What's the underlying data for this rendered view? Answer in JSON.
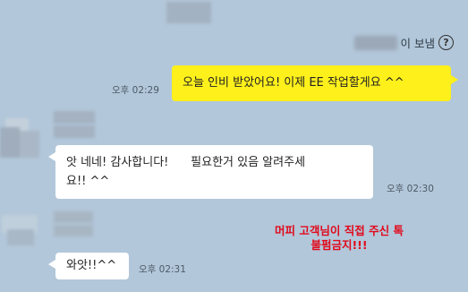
{
  "header": {
    "sent_to_suffix": "이 보냄",
    "help_icon": "question-circle-icon"
  },
  "messages": [
    {
      "side": "me",
      "text": "오늘 인비 받았어요! 이제 EE 작업할게요 ^^",
      "time": "오후 02:29"
    },
    {
      "side": "other",
      "text_line1": "앗 네네! 감사합니다!      필요한거 있음 알려주세",
      "text_line2": "요!! ^^",
      "time": "오후 02:30"
    },
    {
      "side": "other",
      "text": "와앗!!^^",
      "time": "오후 02:31"
    }
  ],
  "watermark": {
    "line1": "머피 고객님이 직접 주신 톡",
    "line2": "불펌금지!!!",
    "color": "#e1091b"
  },
  "colors": {
    "background": "#b2c7da",
    "my_bubble": "#fef01b",
    "other_bubble": "#ffffff"
  }
}
